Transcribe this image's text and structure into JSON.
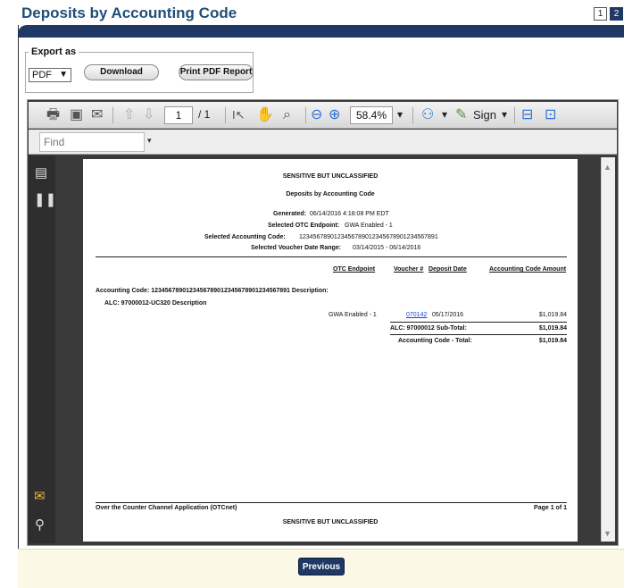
{
  "page": {
    "title": "Deposits by Accounting Code",
    "pager": [
      "1",
      "2"
    ]
  },
  "export": {
    "legend": "Export as",
    "format_value": "PDF",
    "download_label": "Download",
    "print_label": "Print PDF Report"
  },
  "viewer": {
    "page_current": "1",
    "page_total": "/ 1",
    "zoom": "58.4%",
    "sign_label": "Sign",
    "find_placeholder": "Find"
  },
  "report": {
    "classification_top": "SENSITIVE BUT UNCLASSIFIED",
    "title": "Deposits by Accounting Code",
    "generated_label": "Generated:",
    "generated_value": "06/14/2016 4:18:08 PM EDT",
    "otc_endpoint_label": "Selected OTC Endpoint:",
    "otc_endpoint_value": "GWA Enabled - 1",
    "accounting_code_label": "Selected Accounting Code:",
    "accounting_code_value": "1234567890123456789012345678901234567891",
    "voucher_range_label": "Selected Voucher Date Range:",
    "voucher_range_value": "03/14/2015 - 06/14/2016",
    "columns": [
      "OTC Endpoint",
      "Voucher #",
      "Deposit Date",
      "Accounting Code Amount"
    ],
    "acct_code_row": "Accounting Code:  1234567890123456789012345678901234567891   Description:",
    "alc_row": "ALC:  97000012-UC320 Description",
    "detail": {
      "endpoint": "GWA Enabled - 1",
      "voucher": "070142",
      "deposit_date": "05/17/2016",
      "amount": "$1,019.84"
    },
    "alc_subtotal_label": "ALC:  97000012 Sub-Total:",
    "alc_subtotal_value": "$1,019.84",
    "code_total_label": "Accounting Code - Total:",
    "code_total_value": "$1,019.84",
    "footer_app": "Over the Counter Channel Application (OTCnet)",
    "footer_page": "Page 1 of 1",
    "classification_bottom": "SENSITIVE BUT UNCLASSIFIED"
  },
  "nav": {
    "previous_label": "Previous"
  },
  "colors": {
    "brand_blue": "#1f3864",
    "title_blue": "#1f4e79",
    "link_blue": "#1a3fd6",
    "footer_band": "#fbf8e6"
  }
}
